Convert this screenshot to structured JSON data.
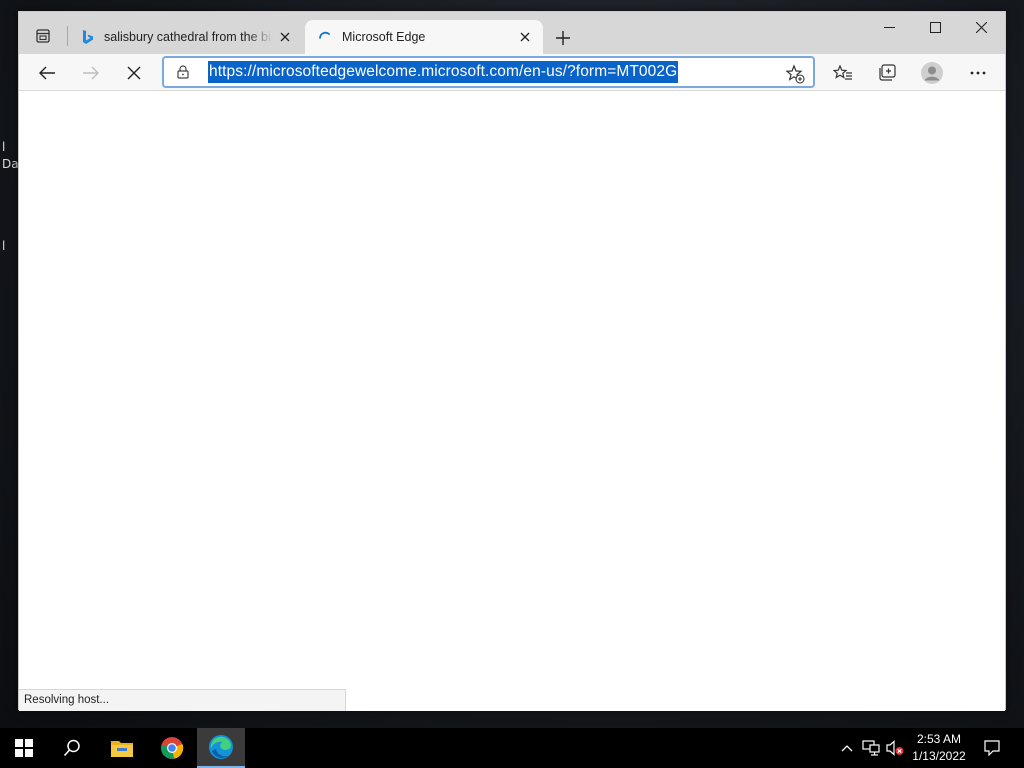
{
  "desktop": {
    "label_1": "l",
    "label_2": "Da",
    "label_3": "l"
  },
  "browser": {
    "tabs": [
      {
        "title": "salisbury cathedral from the bish",
        "active": false,
        "icon": "bing-icon"
      },
      {
        "title": "Microsoft Edge",
        "active": true,
        "icon": "loading-spinner-icon"
      }
    ],
    "address_bar": {
      "url": "https://microsoftedgewelcome.microsoft.com/en-us/?form=MT002G"
    },
    "status_text": "Resolving host..."
  },
  "taskbar": {
    "apps": [
      "windows-start-icon",
      "search-icon",
      "file-explorer-icon",
      "chrome-icon",
      "edge-icon"
    ],
    "clock": {
      "time": "2:53 AM",
      "date": "1/13/2022"
    }
  },
  "colors": {
    "selection": "#0a63c9",
    "accent": "#7aa9dd"
  }
}
